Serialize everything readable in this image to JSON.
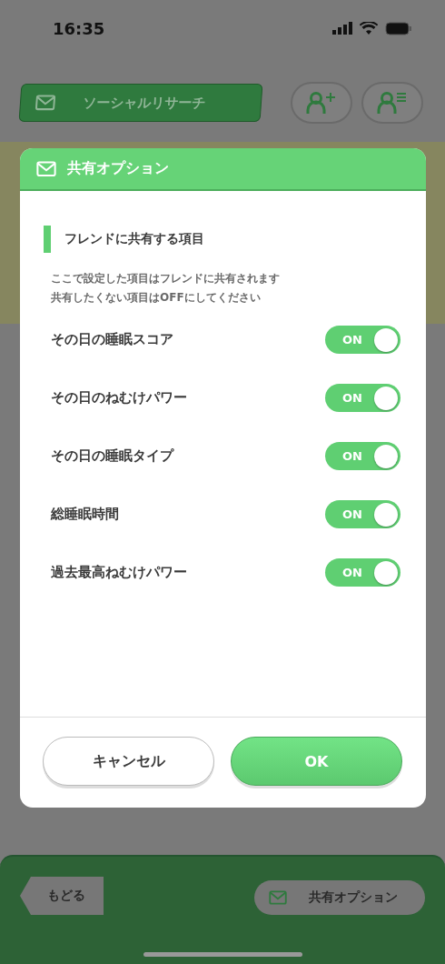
{
  "status_bar": {
    "time": "16:35"
  },
  "header": {
    "title": "ソーシャルリサーチ"
  },
  "dialog": {
    "title": "共有オプション",
    "section_title": "フレンドに共有する項目",
    "description": [
      "ここで設定した項目はフレンドに共有されます",
      "共有したくない項目はOFFにしてください"
    ],
    "options": [
      {
        "label": "その日の睡眠スコア",
        "on": true,
        "switch_text": "ON"
      },
      {
        "label": "その日のねむけパワー",
        "on": true,
        "switch_text": "ON"
      },
      {
        "label": "その日の睡眠タイプ",
        "on": true,
        "switch_text": "ON"
      },
      {
        "label": "総睡眠時間",
        "on": true,
        "switch_text": "ON"
      },
      {
        "label": "過去最高ねむけパワー",
        "on": true,
        "switch_text": "ON"
      }
    ],
    "buttons": [
      {
        "label": "キャンセル",
        "kind": "secondary"
      },
      {
        "label": "OK",
        "kind": "primary"
      }
    ]
  },
  "bottom_bar": {
    "back": "もどる",
    "share": "共有オプション"
  }
}
